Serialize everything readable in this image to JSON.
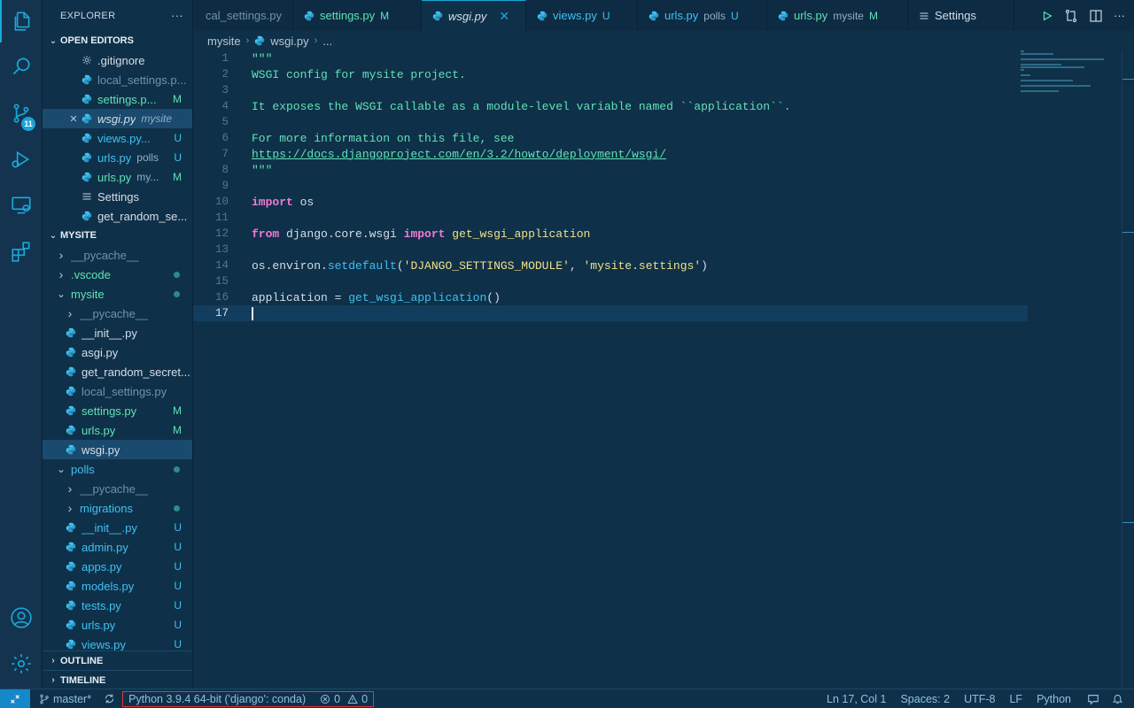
{
  "colors": {
    "accent": "#19a9d9",
    "modified": "#5fe3b5",
    "untracked": "#3ec2f2",
    "keyword": "#f07ad7",
    "string": "#f1e089",
    "highlight_border": "#e2333a"
  },
  "activity_bar": {
    "items": [
      {
        "name": "explorer-icon",
        "active": true
      },
      {
        "name": "search-icon"
      },
      {
        "name": "source-control-icon",
        "badge": "11"
      },
      {
        "name": "run-debug-icon"
      },
      {
        "name": "remote-explorer-icon"
      },
      {
        "name": "extensions-icon"
      }
    ],
    "bottom": [
      {
        "name": "account-icon"
      },
      {
        "name": "settings-gear-icon"
      }
    ]
  },
  "sidebar": {
    "title": "EXPLORER",
    "more": "···",
    "open_editors": {
      "label": "OPEN EDITORS",
      "items": [
        {
          "name": ".gitignore",
          "icon": "gear",
          "color": "c-plain",
          "status": ""
        },
        {
          "name": "local_settings.p...",
          "icon": "python",
          "color": "c-ign",
          "status": ""
        },
        {
          "name": "settings.p...",
          "icon": "python",
          "color": "c-mod",
          "status": "M"
        },
        {
          "name": "wsgi.py",
          "desc": "mysite",
          "icon": "python",
          "color": "c-plain",
          "status": "",
          "active": true
        },
        {
          "name": "views.py...",
          "icon": "python",
          "color": "c-unt",
          "status": "U"
        },
        {
          "name": "urls.py",
          "desc": "polls",
          "icon": "python",
          "color": "c-unt",
          "status": "U"
        },
        {
          "name": "urls.py",
          "desc": "my...",
          "icon": "python",
          "color": "c-mod",
          "status": "M"
        },
        {
          "name": "Settings",
          "icon": "list",
          "color": "c-plain",
          "status": ""
        },
        {
          "name": "get_random_se...",
          "icon": "python",
          "color": "c-plain",
          "status": ""
        }
      ]
    },
    "project": {
      "label": "MYSITE",
      "items": [
        {
          "name": "__pycache__",
          "type": "folder",
          "open": false,
          "depth": 0,
          "color": "c-ign"
        },
        {
          "name": ".vscode",
          "type": "folder",
          "open": false,
          "depth": 0,
          "color": "c-mod",
          "dot": true
        },
        {
          "name": "mysite",
          "type": "folder",
          "open": true,
          "depth": 0,
          "color": "c-mod",
          "dot": true
        },
        {
          "name": "__pycache__",
          "type": "folder",
          "open": false,
          "depth": 1,
          "color": "c-ign"
        },
        {
          "name": "__init__.py",
          "type": "file",
          "depth": 1,
          "color": "c-plain"
        },
        {
          "name": "asgi.py",
          "type": "file",
          "depth": 1,
          "color": "c-plain"
        },
        {
          "name": "get_random_secret...",
          "type": "file",
          "depth": 1,
          "color": "c-plain"
        },
        {
          "name": "local_settings.py",
          "type": "file",
          "depth": 1,
          "color": "c-ign"
        },
        {
          "name": "settings.py",
          "type": "file",
          "depth": 1,
          "color": "c-mod",
          "status": "M"
        },
        {
          "name": "urls.py",
          "type": "file",
          "depth": 1,
          "color": "c-mod",
          "status": "M"
        },
        {
          "name": "wsgi.py",
          "type": "file",
          "depth": 1,
          "color": "c-plain",
          "selected": true
        },
        {
          "name": "polls",
          "type": "folder",
          "open": true,
          "depth": 0,
          "color": "c-unt",
          "dot": true
        },
        {
          "name": "__pycache__",
          "type": "folder",
          "open": false,
          "depth": 1,
          "color": "c-ign"
        },
        {
          "name": "migrations",
          "type": "folder",
          "open": false,
          "depth": 1,
          "color": "c-unt",
          "dot": true
        },
        {
          "name": "__init__.py",
          "type": "file",
          "depth": 1,
          "color": "c-unt",
          "status": "U"
        },
        {
          "name": "admin.py",
          "type": "file",
          "depth": 1,
          "color": "c-unt",
          "status": "U"
        },
        {
          "name": "apps.py",
          "type": "file",
          "depth": 1,
          "color": "c-unt",
          "status": "U"
        },
        {
          "name": "models.py",
          "type": "file",
          "depth": 1,
          "color": "c-unt",
          "status": "U"
        },
        {
          "name": "tests.py",
          "type": "file",
          "depth": 1,
          "color": "c-unt",
          "status": "U"
        },
        {
          "name": "urls.py",
          "type": "file",
          "depth": 1,
          "color": "c-unt",
          "status": "U"
        },
        {
          "name": "views.py",
          "type": "file",
          "depth": 1,
          "color": "c-unt",
          "status": "U"
        }
      ]
    },
    "outline_label": "OUTLINE",
    "timeline_label": "TIMELINE"
  },
  "tabs": [
    {
      "label": "cal_settings.py",
      "icon": false,
      "color": "c-ign"
    },
    {
      "label": "settings.py",
      "status": "M",
      "color": "c-mod",
      "icon": true
    },
    {
      "label": "wsgi.py",
      "active": true,
      "color": "c-plain",
      "icon": true,
      "close": "✕"
    },
    {
      "label": "views.py",
      "status": "U",
      "color": "c-unt",
      "icon": true
    },
    {
      "label": "urls.py",
      "desc": "polls",
      "status": "U",
      "color": "c-unt",
      "icon": true
    },
    {
      "label": "urls.py",
      "desc": "mysite",
      "status": "M",
      "color": "c-mod",
      "icon": true
    },
    {
      "label": "Settings",
      "color": "c-plain",
      "list": true
    }
  ],
  "breadcrumb": [
    "mysite",
    "wsgi.py",
    "..."
  ],
  "editor": {
    "current_line": 17,
    "lines": [
      [
        [
          "\"\"\"",
          "tk-doc"
        ]
      ],
      [
        [
          "WSGI config for mysite project.",
          "tk-doc"
        ]
      ],
      [],
      [
        [
          "It exposes the WSGI callable as a module-level variable named ``application``.",
          "tk-doc"
        ]
      ],
      [],
      [
        [
          "For more information on this file, see",
          "tk-doc"
        ]
      ],
      [
        [
          "https://docs.djangoproject.com/en/3.2/howto/deployment/wsgi/",
          "tk-link"
        ]
      ],
      [
        [
          "\"\"\"",
          "tk-doc"
        ]
      ],
      [],
      [
        [
          "import",
          "tk-kw"
        ],
        [
          " os",
          "tk-id"
        ]
      ],
      [],
      [
        [
          "from",
          "tk-kw"
        ],
        [
          " django.core.wsgi ",
          "tk-id"
        ],
        [
          "import",
          "tk-kw"
        ],
        [
          " get_wsgi_application",
          "tk-fn"
        ]
      ],
      [],
      [
        [
          "os.environ.",
          "tk-id"
        ],
        [
          "setdefault",
          "tk-call"
        ],
        [
          "(",
          "tk-id"
        ],
        [
          "'DJANGO_SETTINGS_MODULE'",
          "tk-str"
        ],
        [
          ", ",
          "tk-id"
        ],
        [
          "'mysite.settings'",
          "tk-str"
        ],
        [
          ")",
          "tk-id"
        ]
      ],
      [],
      [
        [
          "application",
          "tk-id"
        ],
        [
          " = ",
          "tk-id"
        ],
        [
          "get_wsgi_application",
          "tk-call"
        ],
        [
          "()",
          "tk-id"
        ]
      ],
      []
    ]
  },
  "statusbar": {
    "branch": "master*",
    "interpreter": "Python 3.9.4 64-bit ('django': conda)",
    "errors": "0",
    "warnings": "0",
    "position": "Ln 17, Col 1",
    "spaces": "Spaces: 2",
    "encoding": "UTF-8",
    "eol": "LF",
    "language": "Python"
  }
}
